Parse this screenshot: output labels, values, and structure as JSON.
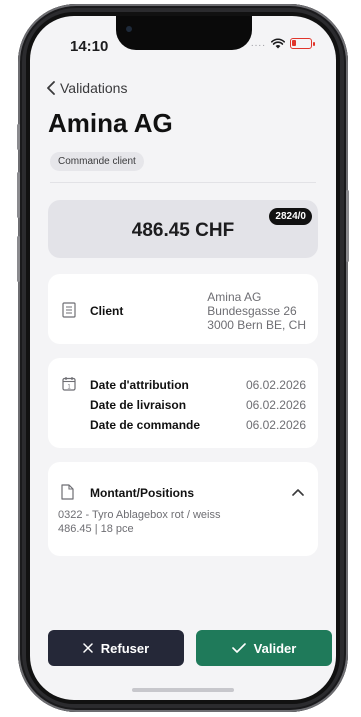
{
  "status_bar": {
    "time": "14:10",
    "signal_dots": "....",
    "battery_color": "#e0352b"
  },
  "header": {
    "back_label": "Validations",
    "title": "Amina AG",
    "tag": "Commande client"
  },
  "amount_card": {
    "amount": "486.45 CHF",
    "reference": "2824/0"
  },
  "client": {
    "label": "Client",
    "address_lines": [
      "Amina AG",
      "Bundesgasse 26",
      "3000 Bern BE, CH"
    ]
  },
  "dates": [
    {
      "label": "Date d'attribution",
      "value": "06.02.2026"
    },
    {
      "label": "Date de livraison",
      "value": "06.02.2026"
    },
    {
      "label": "Date de commande",
      "value": "06.02.2026"
    }
  ],
  "positions": {
    "title": "Montant/Positions",
    "line1": "0322 - Tyro Ablagebox rot / weiss",
    "line2": "486.45 | 18 pce"
  },
  "actions": {
    "refuse_label": "Refuser",
    "validate_label": "Valider"
  },
  "colors": {
    "refuse_bg": "#252838",
    "validate_bg": "#1f7a5a"
  },
  "icons": {
    "back": "chevron-left-icon",
    "client": "building-icon",
    "dates": "calendar-icon",
    "positions": "document-icon",
    "collapse": "chevron-up-icon",
    "refuse": "close-icon",
    "validate": "checkmark-icon",
    "wifi": "wifi-icon",
    "battery": "battery-icon"
  }
}
